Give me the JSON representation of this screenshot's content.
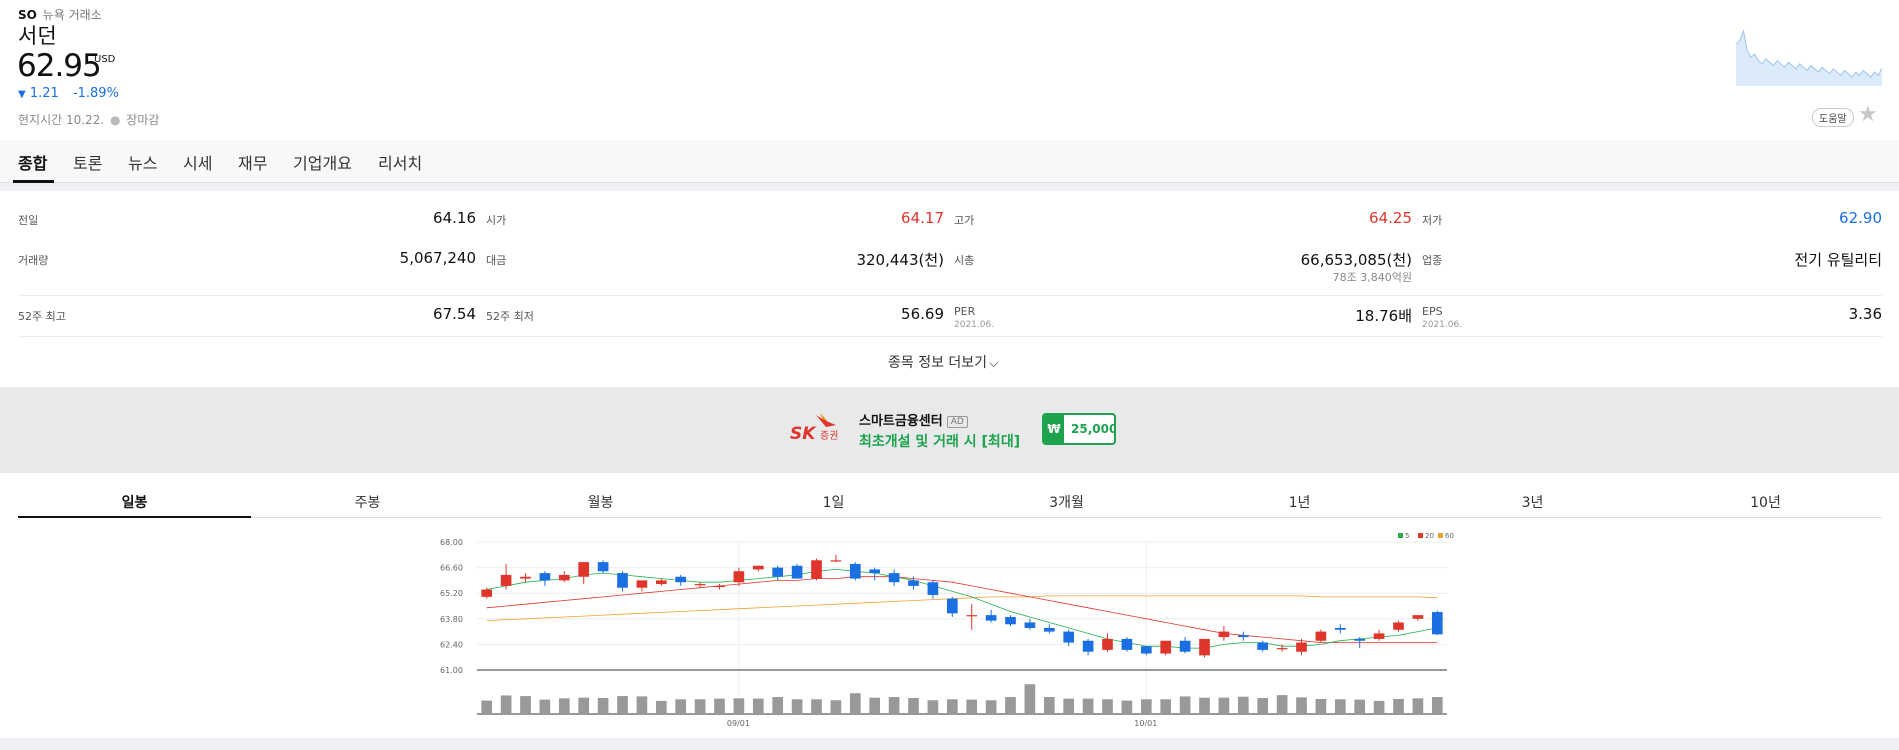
{
  "stock": {
    "symbol": "SO",
    "exchange": "뉴욕 거래소",
    "name": "서던",
    "price": "62.95",
    "currency": "USD",
    "change_arrow": "▼",
    "change": "1.21",
    "change_pct": "-1.89%",
    "local_time_label": "현지시간 10.22.",
    "market_status": "장마감",
    "help_label": "도움말",
    "favorite_icon": "star-icon"
  },
  "tabs": [
    "종합",
    "토론",
    "뉴스",
    "시세",
    "재무",
    "기업개요",
    "리서치"
  ],
  "stats": {
    "prev_close": {
      "label": "전일",
      "value": "64.16"
    },
    "open": {
      "label": "시가",
      "value": "64.17"
    },
    "high": {
      "label": "고가",
      "value": "64.25"
    },
    "low": {
      "label": "저가",
      "value": "62.90"
    },
    "volume": {
      "label": "거래량",
      "value": "5,067,240"
    },
    "amount": {
      "label": "대금",
      "value": "320,443(천)"
    },
    "market_cap": {
      "label": "시총",
      "value": "66,653,085(천)",
      "sub": "78조 3,840억원"
    },
    "industry": {
      "label": "업종",
      "value": "전기 유틸리티"
    },
    "high_52w": {
      "label": "52주 최고",
      "value": "67.54"
    },
    "low_52w": {
      "label": "52주 최저",
      "value": "56.69"
    },
    "per": {
      "label": "PER",
      "date": "2021.06.",
      "value": "18.76배"
    },
    "eps": {
      "label": "EPS",
      "date": "2021.06.",
      "value": "3.36"
    }
  },
  "more_label": "종목 정보 더보기",
  "ad": {
    "brand_main": "SK",
    "brand_sub": "증권",
    "title": "스마트금융센터",
    "tag": "AD",
    "subtitle": "최초개설 및 거래 시 [최대]",
    "currency_symbol": "₩",
    "amount": "25,000",
    "colors": {
      "brand_red": "#e0352b",
      "brand_orange": "#f39a1e",
      "green": "#1ea34d"
    }
  },
  "period_tabs": [
    "일봉",
    "주봉",
    "월봉",
    "1일",
    "3개월",
    "1년",
    "3년",
    "10년"
  ],
  "chart_data": {
    "type": "candlestick",
    "y_ticks": [
      "68.00",
      "66.60",
      "65.20",
      "63.80",
      "62.40",
      "61.00"
    ],
    "ylim": [
      61.0,
      68.0
    ],
    "x_labels": [
      "09/01",
      "10/01"
    ],
    "x_label_index": [
      13,
      34
    ],
    "legend": [
      {
        "name": "5",
        "color": "#22b14c"
      },
      {
        "name": "20",
        "color": "#e0352b"
      },
      {
        "name": "60",
        "color": "#f0a030"
      }
    ],
    "colors": {
      "up": "#e0352b",
      "down": "#1a6fe3",
      "volume": "#999999"
    },
    "candles": [
      {
        "o": 65.0,
        "c": 65.4,
        "h": 65.5,
        "l": 64.9
      },
      {
        "o": 65.6,
        "c": 66.2,
        "h": 66.8,
        "l": 65.4
      },
      {
        "o": 66.0,
        "c": 66.1,
        "h": 66.3,
        "l": 65.8
      },
      {
        "o": 66.3,
        "c": 65.9,
        "h": 66.4,
        "l": 65.6
      },
      {
        "o": 65.9,
        "c": 66.2,
        "h": 66.4,
        "l": 65.8
      },
      {
        "o": 66.1,
        "c": 66.9,
        "h": 66.9,
        "l": 65.7
      },
      {
        "o": 66.9,
        "c": 66.4,
        "h": 67.0,
        "l": 66.3
      },
      {
        "o": 66.3,
        "c": 65.5,
        "h": 66.4,
        "l": 65.3
      },
      {
        "o": 65.5,
        "c": 65.9,
        "h": 65.9,
        "l": 65.3
      },
      {
        "o": 65.7,
        "c": 65.9,
        "h": 66.0,
        "l": 65.6
      },
      {
        "o": 66.1,
        "c": 65.8,
        "h": 66.2,
        "l": 65.6
      },
      {
        "o": 65.7,
        "c": 65.7,
        "h": 65.8,
        "l": 65.5
      },
      {
        "o": 65.6,
        "c": 65.6,
        "h": 65.7,
        "l": 65.4
      },
      {
        "o": 65.8,
        "c": 66.4,
        "h": 66.6,
        "l": 65.6
      },
      {
        "o": 66.5,
        "c": 66.7,
        "h": 66.7,
        "l": 66.4
      },
      {
        "o": 66.6,
        "c": 66.1,
        "h": 66.7,
        "l": 65.9
      },
      {
        "o": 66.7,
        "c": 66.0,
        "h": 66.8,
        "l": 66.0
      },
      {
        "o": 66.0,
        "c": 67.0,
        "h": 67.1,
        "l": 65.9
      },
      {
        "o": 67.0,
        "c": 67.0,
        "h": 67.3,
        "l": 66.9
      },
      {
        "o": 66.8,
        "c": 66.0,
        "h": 66.9,
        "l": 65.9
      },
      {
        "o": 66.5,
        "c": 66.3,
        "h": 66.6,
        "l": 65.9
      },
      {
        "o": 66.3,
        "c": 65.8,
        "h": 66.5,
        "l": 65.6
      },
      {
        "o": 65.9,
        "c": 65.6,
        "h": 66.1,
        "l": 65.4
      },
      {
        "o": 65.8,
        "c": 65.1,
        "h": 65.9,
        "l": 64.9
      },
      {
        "o": 64.9,
        "c": 64.1,
        "h": 65.0,
        "l": 63.9
      },
      {
        "o": 64.0,
        "c": 64.0,
        "h": 64.6,
        "l": 63.2
      },
      {
        "o": 64.0,
        "c": 63.7,
        "h": 64.3,
        "l": 63.6
      },
      {
        "o": 63.9,
        "c": 63.5,
        "h": 64.0,
        "l": 63.4
      },
      {
        "o": 63.6,
        "c": 63.3,
        "h": 63.8,
        "l": 63.2
      },
      {
        "o": 63.3,
        "c": 63.1,
        "h": 63.5,
        "l": 63.0
      },
      {
        "o": 63.1,
        "c": 62.5,
        "h": 63.2,
        "l": 62.3
      },
      {
        "o": 62.6,
        "c": 62.0,
        "h": 62.7,
        "l": 61.8
      },
      {
        "o": 62.1,
        "c": 62.7,
        "h": 63.0,
        "l": 62.0
      },
      {
        "o": 62.7,
        "c": 62.1,
        "h": 62.8,
        "l": 62.0
      },
      {
        "o": 62.3,
        "c": 61.9,
        "h": 62.3,
        "l": 61.8
      },
      {
        "o": 61.9,
        "c": 62.6,
        "h": 62.6,
        "l": 61.8
      },
      {
        "o": 62.6,
        "c": 62.0,
        "h": 62.8,
        "l": 61.9
      },
      {
        "o": 61.8,
        "c": 62.7,
        "h": 62.7,
        "l": 61.7
      },
      {
        "o": 62.8,
        "c": 63.1,
        "h": 63.4,
        "l": 62.6
      },
      {
        "o": 62.9,
        "c": 62.8,
        "h": 63.1,
        "l": 62.6
      },
      {
        "o": 62.5,
        "c": 62.1,
        "h": 62.6,
        "l": 62.0
      },
      {
        "o": 62.2,
        "c": 62.2,
        "h": 62.4,
        "l": 62.0
      },
      {
        "o": 62.0,
        "c": 62.5,
        "h": 62.7,
        "l": 61.8
      },
      {
        "o": 62.6,
        "c": 63.1,
        "h": 63.2,
        "l": 62.5
      },
      {
        "o": 63.3,
        "c": 63.2,
        "h": 63.5,
        "l": 63.0
      },
      {
        "o": 62.7,
        "c": 62.6,
        "h": 62.8,
        "l": 62.2
      },
      {
        "o": 62.7,
        "c": 63.0,
        "h": 63.2,
        "l": 62.6
      },
      {
        "o": 63.2,
        "c": 63.6,
        "h": 63.7,
        "l": 63.1
      },
      {
        "o": 63.8,
        "c": 64.0,
        "h": 64.0,
        "l": 63.7
      },
      {
        "o": 64.17,
        "c": 62.95,
        "h": 64.25,
        "l": 62.9
      }
    ],
    "ma5": [
      65.4,
      65.6,
      65.8,
      65.9,
      66.0,
      66.2,
      66.3,
      66.2,
      66.1,
      66.0,
      65.9,
      65.8,
      65.8,
      65.9,
      66.0,
      66.1,
      66.2,
      66.4,
      66.5,
      66.4,
      66.3,
      66.1,
      65.9,
      65.6,
      65.3,
      65.0,
      64.6,
      64.2,
      63.9,
      63.6,
      63.3,
      63.0,
      62.7,
      62.5,
      62.3,
      62.3,
      62.2,
      62.2,
      62.4,
      62.5,
      62.5,
      62.3,
      62.3,
      62.4,
      62.6,
      62.7,
      62.8,
      62.9,
      63.1,
      63.3
    ],
    "ma20": [
      64.4,
      64.5,
      64.6,
      64.7,
      64.8,
      64.9,
      65.0,
      65.1,
      65.2,
      65.3,
      65.4,
      65.5,
      65.6,
      65.7,
      65.8,
      65.9,
      65.9,
      66.0,
      66.0,
      66.1,
      66.1,
      66.1,
      66.0,
      65.9,
      65.8,
      65.6,
      65.4,
      65.2,
      65.0,
      64.8,
      64.6,
      64.4,
      64.2,
      64.0,
      63.8,
      63.6,
      63.4,
      63.2,
      63.0,
      62.9,
      62.8,
      62.7,
      62.6,
      62.5,
      62.5,
      62.5,
      62.5,
      62.5,
      62.5,
      62.5
    ],
    "ma60": [
      63.7,
      63.75,
      63.8,
      63.85,
      63.9,
      63.95,
      64.0,
      64.05,
      64.1,
      64.15,
      64.2,
      64.25,
      64.3,
      64.35,
      64.4,
      64.45,
      64.5,
      64.55,
      64.6,
      64.65,
      64.7,
      64.75,
      64.8,
      64.85,
      64.9,
      64.95,
      65.0,
      65.0,
      65.0,
      65.05,
      65.05,
      65.05,
      65.05,
      65.05,
      65.05,
      65.05,
      65.05,
      65.05,
      65.05,
      65.05,
      65.05,
      65.05,
      65.05,
      65.0,
      65.0,
      65.0,
      65.0,
      65.0,
      65.0,
      64.95
    ],
    "volume": [
      4.2,
      5.8,
      5.6,
      4.5,
      4.9,
      5.1,
      5.0,
      5.6,
      5.5,
      4.1,
      4.6,
      4.6,
      4.8,
      4.9,
      4.8,
      5.3,
      4.6,
      4.6,
      4.3,
      6.5,
      5.1,
      5.3,
      5.0,
      4.3,
      4.6,
      4.5,
      4.3,
      5.3,
      9.3,
      5.3,
      4.8,
      4.8,
      4.6,
      4.2,
      4.6,
      4.6,
      5.5,
      5.1,
      5.1,
      5.4,
      5.0,
      5.9,
      5.2,
      4.7,
      4.6,
      4.5,
      4.1,
      4.7,
      4.9,
      5.3
    ]
  },
  "sparkline": [
    64.4,
    64.6,
    65.2,
    64.0,
    63.6,
    63.8,
    63.4,
    63.2,
    63.5,
    63.3,
    63.1,
    63.4,
    63.2,
    63.0,
    63.3,
    63.1,
    62.9,
    63.2,
    63.0,
    62.8,
    63.1,
    62.9,
    62.7,
    63.0,
    62.8,
    62.6,
    62.9,
    62.7,
    62.5,
    62.8,
    62.6,
    62.4,
    62.7,
    62.5,
    62.8,
    62.6,
    62.4,
    62.7,
    62.5,
    62.95
  ]
}
